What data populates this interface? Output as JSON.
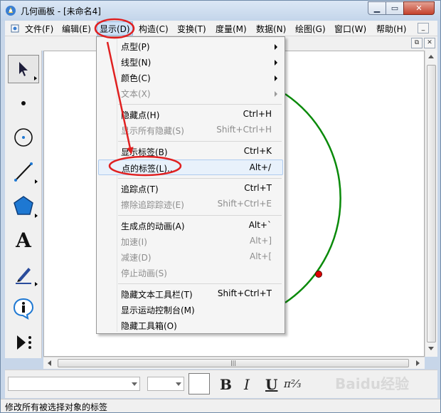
{
  "window": {
    "title": "几何画板 - [未命名4]",
    "min_glyph": "▁",
    "max_glyph": "▭",
    "close_glyph": "✕"
  },
  "menubar": {
    "items": [
      "文件(F)",
      "编辑(E)",
      "显示(D)",
      "构造(C)",
      "变换(T)",
      "度量(M)",
      "数据(N)",
      "绘图(G)",
      "窗口(W)",
      "帮助(H)"
    ],
    "active": "显示(D)",
    "mdi_min_glyph": "_"
  },
  "mdi": {
    "restore_glyph": "⧉",
    "close_glyph": "✕"
  },
  "toolbox": {
    "tools": [
      "select-arrow-icon",
      "point-icon",
      "compass-icon",
      "line-icon",
      "polygon-icon",
      "text-tool-icon",
      "marker-icon",
      "info-icon",
      "custom-tool-icon"
    ],
    "text_tool_glyph": "A"
  },
  "display_menu": {
    "items": [
      {
        "label": "点型(P)",
        "shortcut": "",
        "submenu": true,
        "enabled": true
      },
      {
        "label": "线型(N)",
        "shortcut": "",
        "submenu": true,
        "enabled": true
      },
      {
        "label": "颜色(C)",
        "shortcut": "",
        "submenu": true,
        "enabled": true
      },
      {
        "label": "文本(X)",
        "shortcut": "",
        "submenu": true,
        "enabled": false
      },
      {
        "label": "隐藏点(H)",
        "shortcut": "Ctrl+H",
        "submenu": false,
        "enabled": true
      },
      {
        "label": "显示所有隐藏(S)",
        "shortcut": "Shift+Ctrl+H",
        "submenu": false,
        "enabled": false
      },
      {
        "label": "显示标签(B)",
        "shortcut": "Ctrl+K",
        "submenu": false,
        "enabled": true
      },
      {
        "label": "点的标签(L)...",
        "shortcut": "Alt+/",
        "submenu": false,
        "enabled": true,
        "highlighted": true
      },
      {
        "label": "追踪点(T)",
        "shortcut": "Ctrl+T",
        "submenu": false,
        "enabled": true
      },
      {
        "label": "擦除追踪踪迹(E)",
        "shortcut": "Shift+Ctrl+E",
        "submenu": false,
        "enabled": false
      },
      {
        "label": "生成点的动画(A)",
        "shortcut": "Alt+`",
        "submenu": false,
        "enabled": true
      },
      {
        "label": "加速(I)",
        "shortcut": "Alt+]",
        "submenu": false,
        "enabled": false
      },
      {
        "label": "减速(D)",
        "shortcut": "Alt+[",
        "submenu": false,
        "enabled": false
      },
      {
        "label": "停止动画(S)",
        "shortcut": "",
        "submenu": false,
        "enabled": false
      },
      {
        "label": "隐藏文本工具栏(T)",
        "shortcut": "Shift+Ctrl+T",
        "submenu": false,
        "enabled": true
      },
      {
        "label": "显示运动控制台(M)",
        "shortcut": "",
        "submenu": false,
        "enabled": true
      },
      {
        "label": "隐藏工具箱(O)",
        "shortcut": "",
        "submenu": false,
        "enabled": true
      }
    ]
  },
  "scroll": {
    "hthumb_glyph": "|||"
  },
  "text_toolbar": {
    "bold": "B",
    "italic": "I",
    "underline": "U",
    "math_glyph": "π²⁄₃"
  },
  "status_text": "修改所有被选择对象的标签",
  "watermark": "Baidu经验",
  "colors": {
    "arc": "#0a8a0a",
    "point": "#e00000",
    "annotation": "#e02020",
    "menu_highlight": "#e8f1fb"
  }
}
